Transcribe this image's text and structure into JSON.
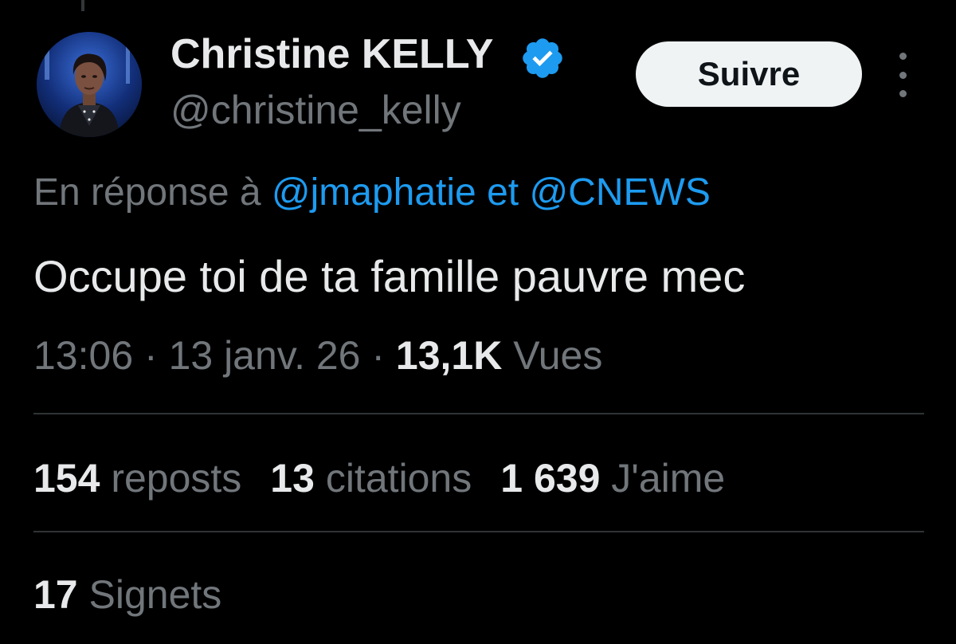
{
  "tweet": {
    "author": {
      "display_name": "Christine KELLY",
      "handle": "@christine_kelly",
      "verified_icon": "verified-badge-icon",
      "avatar_icon": "avatar-photo"
    },
    "follow_label": "Suivre",
    "more_icon": "more-vertical-icon",
    "reply_context": {
      "prefix": "En réponse à ",
      "mention_1": "@jmaphatie",
      "conjunction": " et ",
      "mention_2": "@CNEWS"
    },
    "text": "Occupe toi de ta famille pauvre mec",
    "meta": {
      "time": "13:06",
      "separator": " · ",
      "date": "13 janv. 26",
      "views_count": "13,1K",
      "views_label": " Vues"
    },
    "stats": {
      "reposts_count": "154",
      "reposts_label": " reposts",
      "quotes_count": "13",
      "quotes_label": " citations",
      "likes_count": "1 639",
      "likes_label": " J'aime"
    },
    "bookmarks": {
      "count": "17",
      "label": " Signets"
    }
  },
  "colors": {
    "background": "#000000",
    "text_primary": "#e7e9ea",
    "text_secondary": "#71767b",
    "accent": "#1d9bf0",
    "divider": "#2f3336",
    "follow_bg": "#eff3f4"
  }
}
